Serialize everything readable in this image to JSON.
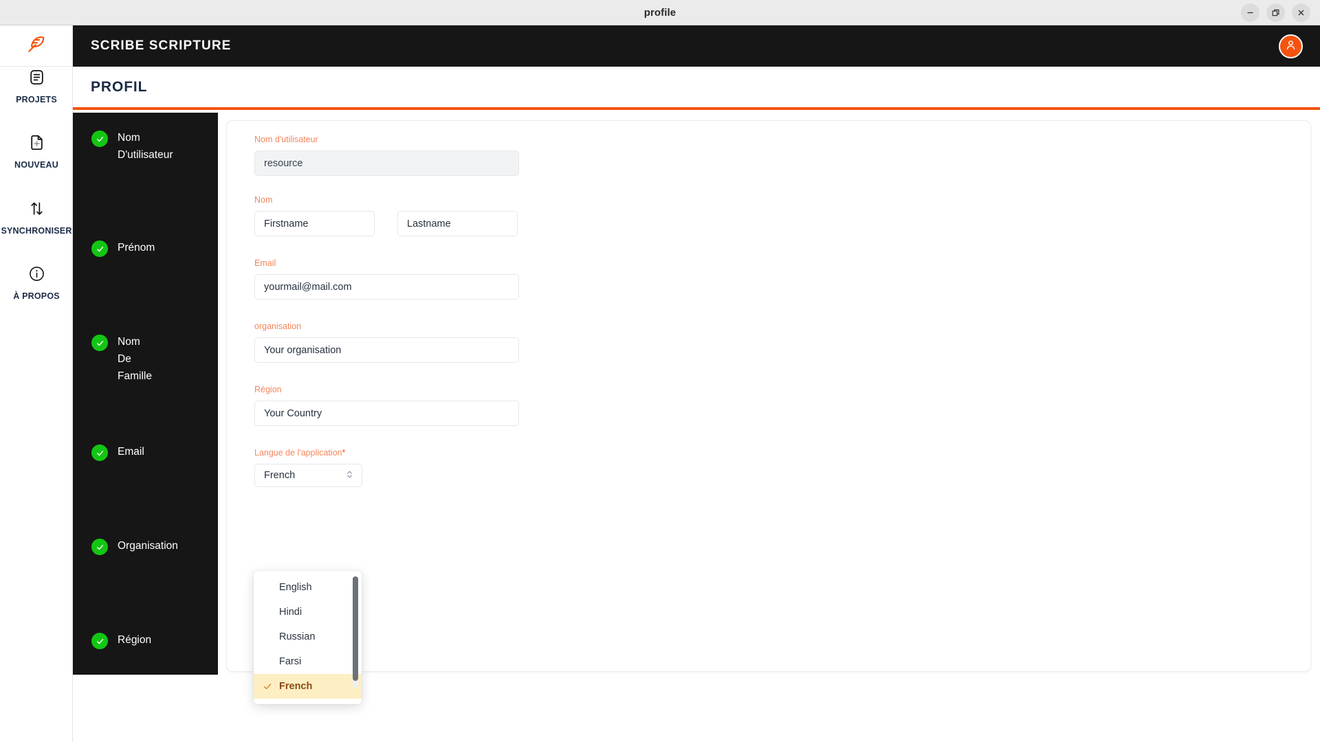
{
  "window": {
    "title": "profile",
    "controls": [
      {
        "name": "minimize",
        "glyph": "minimize-icon"
      },
      {
        "name": "maximize",
        "glyph": "restore-icon"
      },
      {
        "name": "close",
        "glyph": "close-icon"
      }
    ]
  },
  "rail": {
    "logo_icon": "feather-logo-icon",
    "items": [
      {
        "id": "projets",
        "label": "PROJETS",
        "icon": "document-list-icon"
      },
      {
        "id": "nouveau",
        "label": "NOUVEAU",
        "icon": "new-file-plus-icon"
      },
      {
        "id": "synchroniser",
        "label": "SYNCHRONISER",
        "icon": "sync-arrows-icon"
      },
      {
        "id": "apropos",
        "label": "À PROPOS",
        "icon": "info-circle-icon"
      }
    ]
  },
  "header": {
    "brand": "SCRIBE SCRIPTURE",
    "avatar_icon": "user-avatar-icon"
  },
  "page": {
    "title": "PROFIL",
    "accent_color": "#f4530f"
  },
  "checklist": [
    {
      "label": "Nom\nD'utilisateur",
      "state": "complete"
    },
    {
      "label": "Prénom",
      "state": "complete"
    },
    {
      "label": "Nom\nDe\nFamille",
      "state": "complete"
    },
    {
      "label": "Email",
      "state": "complete"
    },
    {
      "label": "Organisation",
      "state": "complete"
    },
    {
      "label": "Région",
      "state": "complete"
    }
  ],
  "form": {
    "username": {
      "label": "Nom d'utilisateur",
      "value": "resource"
    },
    "name": {
      "label": "Nom",
      "firstname": "Firstname",
      "lastname": "Lastname"
    },
    "email": {
      "label": "Email",
      "value": "yourmail@mail.com"
    },
    "organisation": {
      "label": "organisation",
      "value": "Your organisation"
    },
    "region": {
      "label": "Région",
      "value": "Your Country"
    },
    "language": {
      "label": "Langue de l'application",
      "required_mark": "*",
      "selected": "French",
      "options": [
        "English",
        "Hindi",
        "Russian",
        "Farsi",
        "French"
      ]
    }
  }
}
